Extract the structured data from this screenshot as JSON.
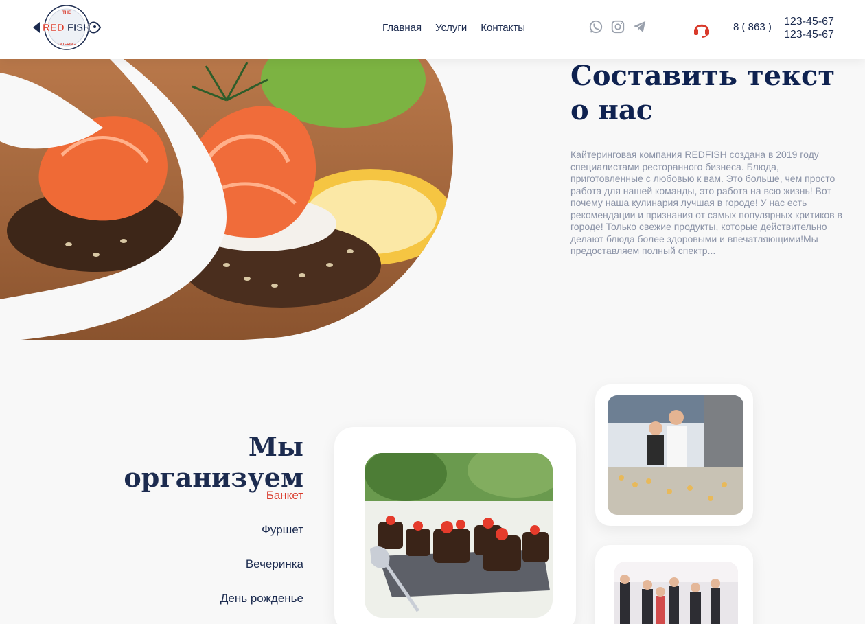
{
  "logo": {
    "top_text": "THE",
    "brand": "RED FISH",
    "bottom_text": "CATERING"
  },
  "nav": {
    "items": [
      "Главная",
      "Услуги",
      "Контакты"
    ]
  },
  "socials": [
    "whatsapp-icon",
    "instagram-icon",
    "telegram-icon"
  ],
  "contact": {
    "code": "8 ( 863 )",
    "phone1": "123-45-67",
    "phone2": "123-45-67"
  },
  "about": {
    "title": "Составить текст о нас",
    "text": "Кайтеринговая компания REDFISH создана в 2019 году специалистами ресторанного бизнеса. Блюда, приготовленные с любовью к вам. Это больше, чем просто работа для нашей команды, это работа на всю жизнь! Вот почему наша кулинария лучшая в городе! У нас есть рекомендации и признания от самых популярных критиков в городе! Только свежие продукты, которые действительно делают блюда более здоровыми и впечатляющими!Мы предоставляем полный спектр..."
  },
  "organize": {
    "title": "Мы организуем",
    "items": [
      "Банкет",
      "Фуршет",
      "Вечеринка",
      "День рожденье"
    ],
    "active": "Банкет"
  },
  "colors": {
    "accent": "#d93a2b",
    "navy": "#0f2250",
    "text": "#1c2b4f",
    "muted": "#8b93a7"
  }
}
